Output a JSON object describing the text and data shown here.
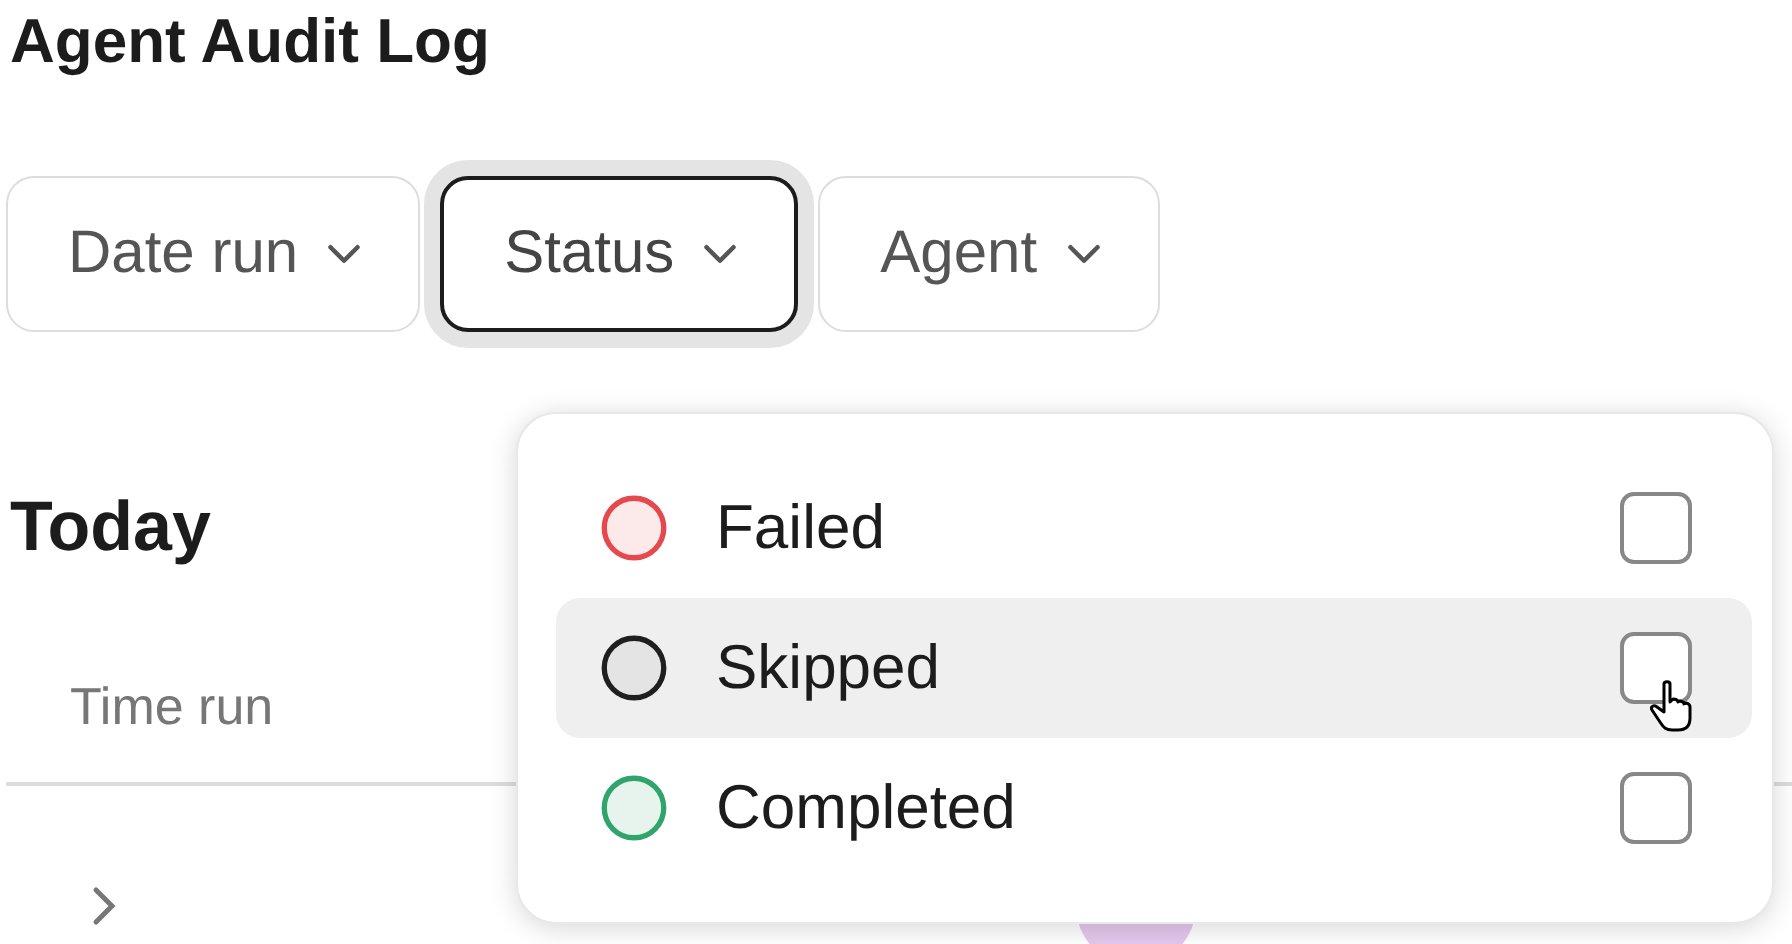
{
  "title": "Agent Audit Log",
  "filters": [
    {
      "label": "Date run",
      "selected": false
    },
    {
      "label": "Status",
      "selected": true
    },
    {
      "label": "Agent",
      "selected": false
    }
  ],
  "section": {
    "title": "Today",
    "column_1": "Time run"
  },
  "status_menu": {
    "items": [
      {
        "label": "Failed",
        "color": "#e5484d",
        "checked": false,
        "highlighted": false
      },
      {
        "label": "Skipped",
        "color": "#1f1f1f",
        "checked": false,
        "highlighted": true
      },
      {
        "label": "Completed",
        "color": "#30a46c",
        "checked": false,
        "highlighted": false
      }
    ]
  }
}
